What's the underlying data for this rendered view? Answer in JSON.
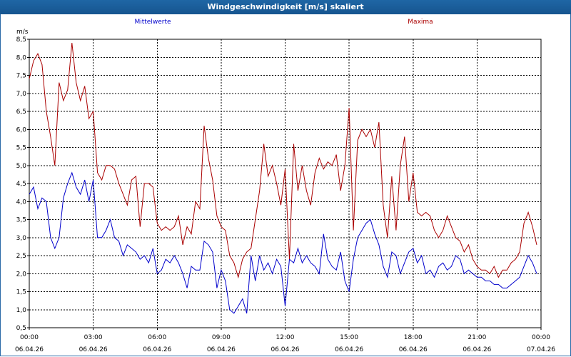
{
  "window": {
    "title": "Windgeschwindigkeit [m/s] skaliert"
  },
  "colors": {
    "titlebar": "#1a5c99",
    "mean": "#0000cc",
    "max": "#aa0000",
    "grid": "#000000"
  },
  "chart_data": {
    "type": "line",
    "title": "Windgeschwindigkeit [m/s] skaliert",
    "ylabel": "m/s",
    "ylim": [
      0.5,
      8.5
    ],
    "yticks": [
      "0,5",
      "1,0",
      "1,5",
      "2,0",
      "2,5",
      "3,0",
      "3,5",
      "4,0",
      "4,5",
      "5,0",
      "5,5",
      "6,0",
      "6,5",
      "7,0",
      "7,5",
      "8,0",
      "8,5"
    ],
    "xlim_hours": [
      0,
      24
    ],
    "xticks": [
      {
        "time": "00:00",
        "date": "06.04.26"
      },
      {
        "time": "03:00",
        "date": "06.04.26"
      },
      {
        "time": "06:00",
        "date": "06.04.26"
      },
      {
        "time": "09:00",
        "date": "06.04.26"
      },
      {
        "time": "12:00",
        "date": "06.04.26"
      },
      {
        "time": "15:00",
        "date": "06.04.26"
      },
      {
        "time": "18:00",
        "date": "06.04.26"
      },
      {
        "time": "21:00",
        "date": "06.04.26"
      },
      {
        "time": "00:00",
        "date": "07.04.26"
      }
    ],
    "grid": true,
    "series": [
      {
        "name": "Mittelwerte",
        "color": "#0000cc",
        "x": [
          0,
          0.2,
          0.4,
          0.6,
          0.8,
          1.0,
          1.2,
          1.4,
          1.6,
          1.8,
          2.0,
          2.2,
          2.4,
          2.6,
          2.8,
          3.0,
          3.2,
          3.4,
          3.6,
          3.8,
          4.0,
          4.2,
          4.4,
          4.6,
          4.8,
          5.0,
          5.2,
          5.4,
          5.6,
          5.8,
          6.0,
          6.2,
          6.4,
          6.6,
          6.8,
          7.0,
          7.2,
          7.4,
          7.6,
          7.8,
          8.0,
          8.2,
          8.4,
          8.6,
          8.8,
          9.0,
          9.2,
          9.4,
          9.6,
          9.8,
          10.0,
          10.2,
          10.4,
          10.6,
          10.8,
          11.0,
          11.2,
          11.4,
          11.6,
          11.8,
          12.0,
          12.2,
          12.4,
          12.6,
          12.8,
          13.0,
          13.2,
          13.4,
          13.6,
          13.8,
          14.0,
          14.2,
          14.4,
          14.6,
          14.8,
          15.0,
          15.2,
          15.4,
          15.6,
          15.8,
          16.0,
          16.2,
          16.4,
          16.6,
          16.8,
          17.0,
          17.2,
          17.4,
          17.6,
          17.8,
          18.0,
          18.2,
          18.4,
          18.6,
          18.8,
          19.0,
          19.2,
          19.4,
          19.6,
          19.8,
          20.0,
          20.2,
          20.4,
          20.6,
          20.8,
          21.0,
          21.2,
          21.4,
          21.6,
          21.8,
          22.0,
          22.2,
          22.4,
          22.6,
          22.8,
          23.0,
          23.2,
          23.4,
          23.6,
          23.8
        ],
        "y": [
          4.2,
          4.4,
          3.8,
          4.1,
          4.0,
          3.0,
          2.7,
          3.0,
          4.1,
          4.5,
          4.8,
          4.4,
          4.2,
          4.6,
          4.0,
          4.6,
          3.0,
          3.0,
          3.2,
          3.5,
          3.0,
          2.9,
          2.5,
          2.8,
          2.7,
          2.6,
          2.4,
          2.5,
          2.3,
          2.7,
          2.0,
          2.1,
          2.4,
          2.3,
          2.5,
          2.3,
          2.0,
          1.6,
          2.2,
          2.1,
          2.1,
          2.9,
          2.8,
          2.6,
          1.6,
          2.1,
          1.8,
          1.0,
          0.9,
          1.1,
          1.3,
          0.9,
          2.5,
          1.8,
          2.5,
          2.1,
          2.3,
          2.0,
          2.4,
          2.2,
          1.1,
          2.4,
          2.3,
          2.7,
          2.3,
          2.5,
          2.3,
          2.2,
          2.0,
          3.1,
          2.4,
          2.2,
          2.1,
          2.6,
          1.8,
          1.5,
          2.4,
          3.0,
          3.2,
          3.4,
          3.5,
          3.1,
          2.8,
          2.2,
          1.9,
          2.6,
          2.5,
          2.0,
          2.3,
          2.6,
          2.7,
          2.3,
          2.5,
          2.0,
          2.1,
          1.9,
          2.2,
          2.3,
          2.1,
          2.2,
          2.5,
          2.4,
          2.0,
          2.1,
          2.0,
          1.9,
          1.9,
          1.8,
          1.8,
          1.7,
          1.7,
          1.6,
          1.6,
          1.7,
          1.8,
          1.9,
          2.2,
          2.5,
          2.3,
          2.0
        ]
      },
      {
        "name": "Maxima",
        "color": "#aa0000",
        "x": [
          0,
          0.2,
          0.4,
          0.6,
          0.8,
          1.0,
          1.2,
          1.4,
          1.6,
          1.8,
          2.0,
          2.2,
          2.4,
          2.6,
          2.8,
          3.0,
          3.2,
          3.4,
          3.6,
          3.8,
          4.0,
          4.2,
          4.4,
          4.6,
          4.8,
          5.0,
          5.2,
          5.4,
          5.6,
          5.8,
          6.0,
          6.2,
          6.4,
          6.6,
          6.8,
          7.0,
          7.2,
          7.4,
          7.6,
          7.8,
          8.0,
          8.2,
          8.4,
          8.6,
          8.8,
          9.0,
          9.2,
          9.4,
          9.6,
          9.8,
          10.0,
          10.2,
          10.4,
          10.6,
          10.8,
          11.0,
          11.2,
          11.4,
          11.6,
          11.8,
          12.0,
          12.2,
          12.4,
          12.6,
          12.8,
          13.0,
          13.2,
          13.4,
          13.6,
          13.8,
          14.0,
          14.2,
          14.4,
          14.6,
          14.8,
          15.0,
          15.2,
          15.4,
          15.6,
          15.8,
          16.0,
          16.2,
          16.4,
          16.6,
          16.8,
          17.0,
          17.2,
          17.4,
          17.6,
          17.8,
          18.0,
          18.2,
          18.4,
          18.6,
          18.8,
          19.0,
          19.2,
          19.4,
          19.6,
          19.8,
          20.0,
          20.2,
          20.4,
          20.6,
          20.8,
          21.0,
          21.2,
          21.4,
          21.6,
          21.8,
          22.0,
          22.2,
          22.4,
          22.6,
          22.8,
          23.0,
          23.2,
          23.4,
          23.6,
          23.8
        ],
        "y": [
          7.4,
          7.9,
          8.1,
          7.8,
          6.5,
          5.8,
          5.0,
          7.3,
          6.8,
          7.1,
          8.4,
          7.3,
          6.8,
          7.2,
          6.3,
          6.5,
          4.8,
          4.6,
          5.0,
          5.0,
          4.9,
          4.5,
          4.2,
          3.9,
          4.6,
          4.7,
          3.3,
          4.5,
          4.5,
          4.4,
          3.4,
          3.2,
          3.3,
          3.2,
          3.3,
          3.6,
          2.8,
          3.3,
          3.1,
          4.0,
          3.8,
          6.1,
          5.2,
          4.6,
          3.6,
          3.3,
          3.2,
          2.5,
          2.3,
          1.9,
          2.4,
          2.6,
          2.7,
          3.5,
          4.3,
          5.6,
          4.7,
          5.0,
          4.5,
          3.9,
          4.9,
          2.4,
          5.6,
          4.3,
          5.0,
          4.3,
          3.9,
          4.8,
          5.2,
          4.9,
          5.1,
          5.0,
          5.3,
          4.3,
          5.0,
          6.6,
          3.2,
          5.7,
          6.0,
          5.8,
          6.0,
          5.5,
          6.2,
          3.9,
          3.0,
          4.7,
          3.2,
          5.0,
          5.8,
          4.0,
          4.8,
          3.7,
          3.6,
          3.7,
          3.6,
          3.2,
          3.0,
          3.2,
          3.6,
          3.3,
          3.0,
          2.9,
          2.6,
          2.8,
          2.4,
          2.2,
          2.1,
          2.1,
          2.0,
          2.2,
          1.9,
          2.1,
          2.1,
          2.3,
          2.4,
          2.6,
          3.4,
          3.7,
          3.3,
          2.8
        ]
      }
    ]
  }
}
